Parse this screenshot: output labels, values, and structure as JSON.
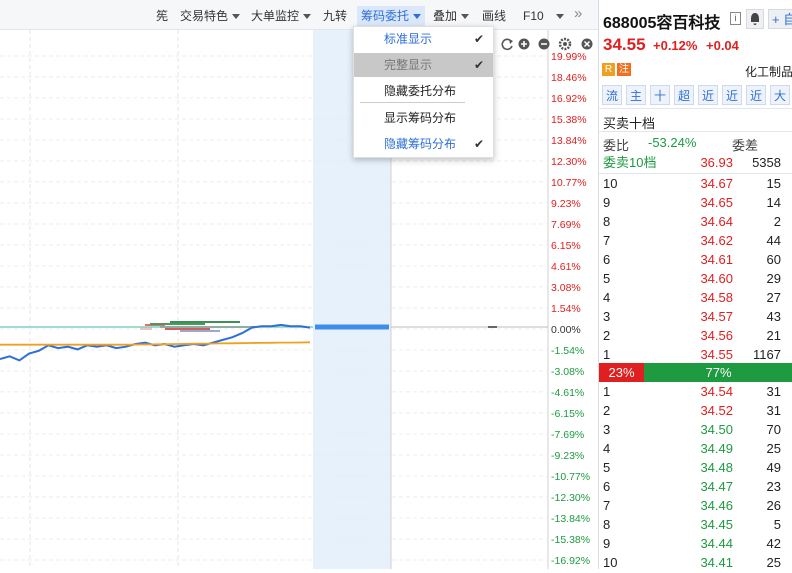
{
  "toolbar": {
    "items": [
      {
        "label": "筅",
        "dropdown": false
      },
      {
        "label": "交易特色",
        "dropdown": true
      },
      {
        "label": "大单监控",
        "dropdown": true
      },
      {
        "label": "九转",
        "dropdown": false
      },
      {
        "label": "筹码委托",
        "dropdown": true,
        "active": true
      },
      {
        "label": "叠加",
        "dropdown": true
      },
      {
        "label": "画线",
        "dropdown": false
      },
      {
        "label": "F10",
        "dropdown": true
      }
    ],
    "more_icon": "double-chevron-right-icon"
  },
  "menu": {
    "items": [
      {
        "label": "标准显示",
        "checked": true,
        "style": "blue"
      },
      {
        "label": "完整显示",
        "checked": true,
        "style": "disabled"
      },
      {
        "label": "隐藏委托分布",
        "checked": false,
        "style": "normal"
      },
      {
        "label": "显示筹码分布",
        "checked": false,
        "style": "normal"
      },
      {
        "label": "隐藏筹码分布",
        "checked": true,
        "style": "blue"
      }
    ]
  },
  "chart_icons": [
    "refresh-icon",
    "zoom-in-icon",
    "zoom-out-icon",
    "settings-icon",
    "close-icon"
  ],
  "chart_data": {
    "type": "line",
    "right_axis_ticks": [
      "19.99%",
      "18.46%",
      "16.92%",
      "15.38%",
      "13.84%",
      "12.30%",
      "10.77%",
      "9.23%",
      "7.69%",
      "6.15%",
      "4.61%",
      "3.08%",
      "1.54%",
      "0.00%",
      "-1.54%",
      "-3.08%",
      "-4.61%",
      "-6.15%",
      "-7.69%",
      "-9.23%",
      "-10.77%",
      "-12.30%",
      "-13.84%",
      "-15.38%",
      "-16.92%"
    ],
    "ylim": [
      -16.92,
      19.99
    ],
    "grid": true,
    "series": [
      {
        "color": "#2e6fd6",
        "values": [
          -2.2,
          -2.0,
          -2.3,
          -1.8,
          -1.6,
          -1.2,
          -1.4,
          -1.3,
          -1.5,
          -1.2,
          -1.3,
          -1.2,
          -1.4,
          -1.3,
          -1.1,
          -1.0,
          -1.2,
          -1.1,
          -1.3,
          -1.2,
          -1.1,
          -1.2,
          -1.0,
          -0.8,
          -0.6,
          -0.3,
          0.1,
          0.2,
          0.2,
          0.3,
          0.2,
          0.2,
          0.1
        ]
      },
      {
        "color": "#f0a020",
        "values": [
          -1.15,
          -1.15,
          -1.15,
          -1.15,
          -1.15,
          -1.15,
          -1.15,
          -1.15,
          -1.15,
          -1.15,
          -1.15,
          -1.15,
          -1.15,
          -1.15,
          -1.14,
          -1.13,
          -1.12,
          -1.11,
          -1.1,
          -1.09,
          -1.08,
          -1.07,
          -1.06,
          -1.05,
          -1.04,
          -1.03,
          -1.02,
          -1.01,
          -1.0,
          -1.0,
          -0.99,
          -0.98
        ]
      }
    ]
  },
  "stock": {
    "code_name": "688005容百科技",
    "info_icon": "info-icon",
    "bell_icon": "bell-icon",
    "add_label": "+ 自",
    "price": "34.55",
    "change_pct": "+0.12%",
    "change_amt": "+0.04",
    "badge_r": "R",
    "badge_zhu": "注",
    "industry": "化工制品:"
  },
  "panel_buttons": [
    "流",
    "主",
    "十",
    "超",
    "近",
    "近",
    "近",
    "大"
  ],
  "order_book": {
    "title": "买卖十档",
    "wei_bi_label": "委比",
    "wei_bi_value": "-53.24%",
    "wei_cha_label": "委差",
    "sell10_label": "委卖10档",
    "sell10_price": "36.93",
    "sell10_vol": "5358",
    "asks": [
      {
        "lv": "10",
        "price": "34.67",
        "vol": "15"
      },
      {
        "lv": "9",
        "price": "34.65",
        "vol": "14"
      },
      {
        "lv": "8",
        "price": "34.64",
        "vol": "2"
      },
      {
        "lv": "7",
        "price": "34.62",
        "vol": "44"
      },
      {
        "lv": "6",
        "price": "34.61",
        "vol": "60"
      },
      {
        "lv": "5",
        "price": "34.60",
        "vol": "29"
      },
      {
        "lv": "4",
        "price": "34.58",
        "vol": "27"
      },
      {
        "lv": "3",
        "price": "34.57",
        "vol": "43"
      },
      {
        "lv": "2",
        "price": "34.56",
        "vol": "21"
      },
      {
        "lv": "1",
        "price": "34.55",
        "vol": "1167"
      }
    ],
    "ratio_red": "23%",
    "ratio_green": "77%",
    "ratio_red_fraction": 0.23,
    "bids": [
      {
        "lv": "1",
        "price": "34.54",
        "vol": "31"
      },
      {
        "lv": "2",
        "price": "34.52",
        "vol": "31"
      },
      {
        "lv": "3",
        "price": "34.50",
        "vol": "70"
      },
      {
        "lv": "4",
        "price": "34.49",
        "vol": "25"
      },
      {
        "lv": "5",
        "price": "34.48",
        "vol": "49"
      },
      {
        "lv": "6",
        "price": "34.47",
        "vol": "23"
      },
      {
        "lv": "7",
        "price": "34.46",
        "vol": "26"
      },
      {
        "lv": "8",
        "price": "34.45",
        "vol": "5"
      },
      {
        "lv": "9",
        "price": "34.44",
        "vol": "42"
      },
      {
        "lv": "10",
        "price": "34.41",
        "vol": "25"
      }
    ]
  }
}
